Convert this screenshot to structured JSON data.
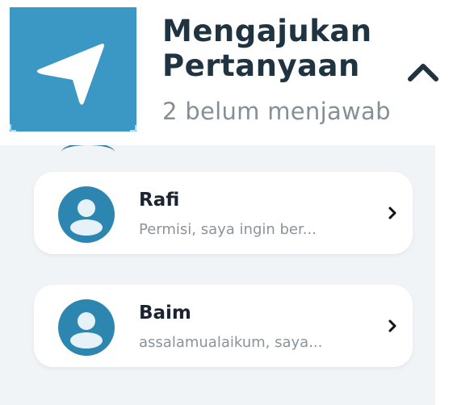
{
  "header": {
    "title_line1": "Mengajukan",
    "title_line2": "Pertanyaan",
    "subtitle": "2 belum menjawab",
    "icon": "navigation-arrow-icon",
    "toggle_icon": "chevron-up-icon"
  },
  "conversations": [
    {
      "name": "Rafi",
      "preview": "Permisi, saya ingin ber...",
      "avatar_icon": "user-avatar-icon",
      "action_icon": "chevron-right-icon"
    },
    {
      "name": "Baim",
      "preview": "assalamualaikum, saya...",
      "avatar_icon": "user-avatar-icon",
      "action_icon": "chevron-right-icon"
    }
  ],
  "colors": {
    "accent": "#3b98c4",
    "avatar": "#2c86b0",
    "title": "#1f3340",
    "subtitle": "#858f96",
    "panel": "#f1f4f6"
  }
}
